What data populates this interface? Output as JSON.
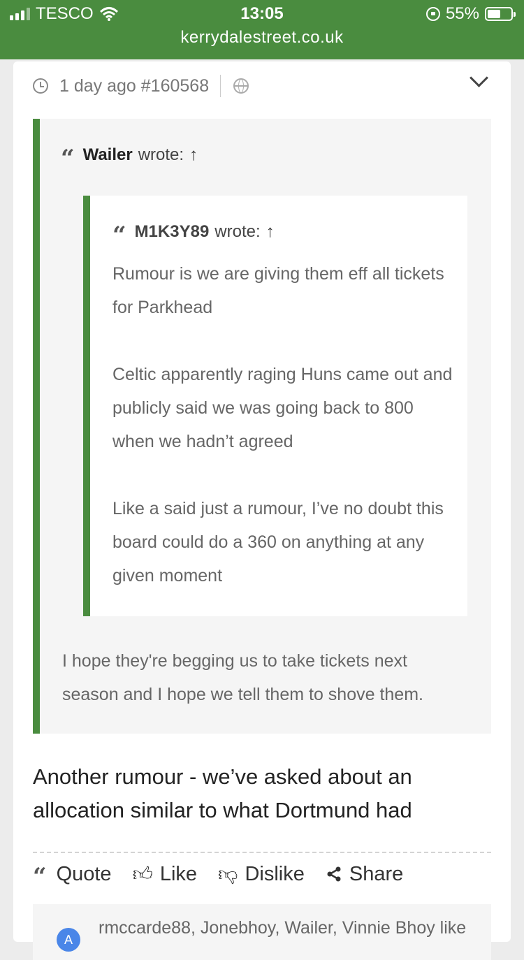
{
  "status_bar": {
    "carrier": "TESCO",
    "time": "13:05",
    "battery": "55%"
  },
  "browser": {
    "url": "kerrydalestreet.co.uk"
  },
  "post": {
    "time_ago": "1 day ago",
    "post_id": "#160568",
    "outer_quote": {
      "author": "Wailer",
      "wrote": "wrote:",
      "reply": "I hope they're begging us to take tickets next season and I hope we tell them to shove them."
    },
    "inner_quote": {
      "author": "M1K3Y89",
      "wrote": "wrote:",
      "paragraphs": [
        "Rumour is we are giving them eff all tickets for Parkhead",
        "Celtic apparently raging Huns came out and publicly said we was going back to 800 when we hadn’t agreed",
        "Like a said just a rumour, I’ve no doubt this board could do a 360 on anything at any given moment"
      ]
    },
    "body": "Another rumour - we’ve asked about an allocation similar to what Dortmund had",
    "actions": {
      "quote": "Quote",
      "like": "Like",
      "dislike": "Dislike",
      "share": "Share"
    },
    "likes": {
      "avatar_letter": "A",
      "text": "rmccarde88, Jonebhoy, Wailer, Vinnie Bhoy like"
    }
  },
  "colors": {
    "accent": "#4a8c3f",
    "quote_bg": "#f5f5f5"
  }
}
